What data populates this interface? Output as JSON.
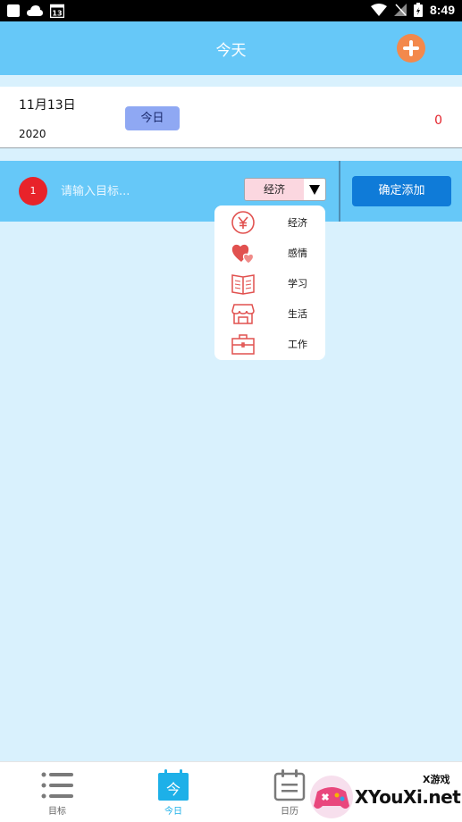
{
  "status_bar": {
    "time": "8:49",
    "calendar_badge": "13"
  },
  "header": {
    "title": "今天"
  },
  "date_card": {
    "month_day": "11月13日",
    "year": "2020",
    "today_label": "今日",
    "count": "0"
  },
  "add_row": {
    "index": "1",
    "input_placeholder": "请输入目标...",
    "input_value": "",
    "selected_category": "经济",
    "confirm_label": "确定添加"
  },
  "category_options": [
    {
      "label": "经济",
      "icon": "yen-icon"
    },
    {
      "label": "感情",
      "icon": "hearts-icon"
    },
    {
      "label": "学习",
      "icon": "book-icon"
    },
    {
      "label": "生活",
      "icon": "store-icon"
    },
    {
      "label": "工作",
      "icon": "briefcase-icon"
    }
  ],
  "bottom_nav": [
    {
      "label": "目标",
      "icon": "list-icon",
      "active": false
    },
    {
      "label": "今日",
      "icon": "calendar-today-icon",
      "active": true
    },
    {
      "label": "日历",
      "icon": "calendar-icon",
      "active": false
    }
  ],
  "watermark": {
    "text": "XYouXi.net",
    "small": "X游戏"
  },
  "colors": {
    "header": "#66c8f8",
    "accent_blue": "#0f7bd8",
    "add_button": "#f3894c",
    "icon_red": "#e1514f",
    "background": "#d9f1fd"
  }
}
